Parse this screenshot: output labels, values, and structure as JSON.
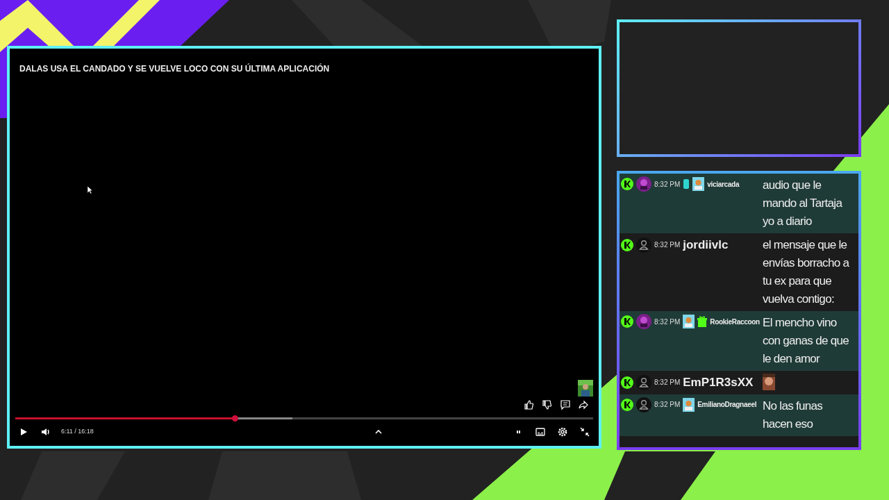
{
  "video": {
    "title": "DALAS USA EL CANDADO Y SE VUELVE LOCO CON SU ÚLTIMA APLICACIÓN",
    "progress": {
      "level": 0.38,
      "buffer": {
        "level": 0.48
      }
    },
    "time": "6:11 / 16:18",
    "playing": false
  },
  "chat": {
    "messages": [
      {
        "time": "8:32 PM",
        "custom_avatar": true,
        "subscriber_badge": true,
        "sticker_badge": true,
        "gift_badge": false,
        "user": "viciarcada",
        "kind": "text",
        "text": "audio que le mando al Tartaja yo a diario",
        "highlight": true
      },
      {
        "time": "8:32 PM",
        "custom_avatar": false,
        "subscriber_badge": false,
        "sticker_badge": false,
        "gift_badge": false,
        "user": "jordiivlc",
        "kind": "text",
        "text": "el mensaje que le envías borracho a tu ex para que vuelva contigo:",
        "highlight": false
      },
      {
        "time": "8:32 PM",
        "custom_avatar": true,
        "subscriber_badge": false,
        "sticker_badge": true,
        "gift_badge": true,
        "user": "RookieRaccoon",
        "kind": "text",
        "text": "El mencho vino con ganas de que le den amor",
        "highlight": true
      },
      {
        "time": "8:32 PM",
        "custom_avatar": false,
        "subscriber_badge": false,
        "sticker_badge": false,
        "gift_badge": false,
        "user": "EmP1R3sXX",
        "kind": "emote",
        "highlight": false
      },
      {
        "time": "8:32 PM",
        "custom_avatar": false,
        "subscriber_badge": false,
        "sticker_badge": true,
        "gift_badge": false,
        "user": "EmilianoDragnaeel",
        "kind": "text",
        "text": "No las funas hacen eso",
        "highlight": true
      }
    ]
  }
}
